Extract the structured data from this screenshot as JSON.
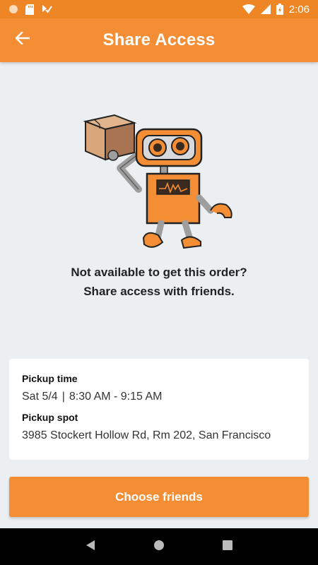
{
  "status_bar": {
    "time": "2:06",
    "left_icons": [
      "circle-notification-icon",
      "sd-card-icon",
      "download-check-icon"
    ],
    "right_icons": [
      "wifi-icon",
      "signal-icon",
      "battery-charging-icon"
    ]
  },
  "app_bar": {
    "title": "Share Access",
    "back_icon": "arrow-left-icon"
  },
  "illustration": {
    "name": "robot-carrying-box",
    "accent_color": "#F48E35"
  },
  "message": {
    "line1": "Not available to get this order?",
    "line2": "Share access with friends."
  },
  "order_card": {
    "pickup_time_label": "Pickup time",
    "pickup_date": "Sat 5/4",
    "separator": "|",
    "pickup_window": "8:30 AM - 9:15 AM",
    "pickup_spot_label": "Pickup spot",
    "pickup_spot": "3985 Stockert Hollow Rd, Rm 202, San Francisco"
  },
  "cta": {
    "label": "Choose friends"
  },
  "nav_bar": {
    "buttons": [
      "back-triangle-icon",
      "home-circle-icon",
      "recents-square-icon"
    ]
  },
  "colors": {
    "primary": "#F48E35",
    "status_bar": "#EE8625",
    "background": "#ECEFF1"
  }
}
